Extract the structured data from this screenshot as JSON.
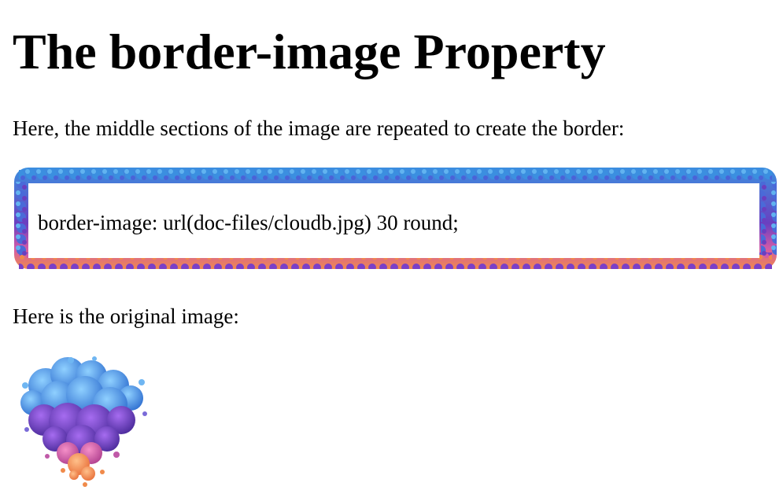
{
  "heading": "The border-image Property",
  "intro": "Here, the middle sections of the image are repeated to create the border:",
  "demo_text": "border-image: url(doc-files/cloudb.jpg) 30 round;",
  "original_label": "Here is the original image:",
  "colors": {
    "cloud_blue": "#3b8fe0",
    "cloud_purple": "#6a3fc0",
    "cloud_pink": "#d25aa8",
    "cloud_orange": "#f08a4a"
  },
  "icons": {
    "border_frame": "cloud-border-frame-icon",
    "original_image": "cloud-heart-image-icon"
  }
}
